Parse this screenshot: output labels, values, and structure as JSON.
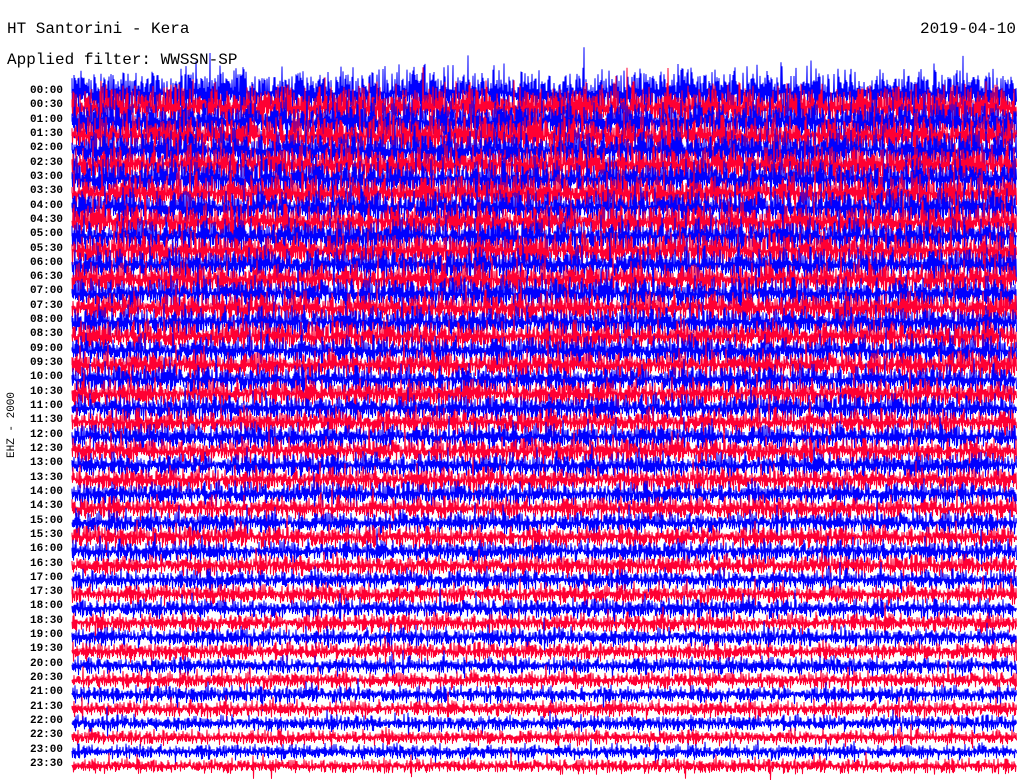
{
  "header": {
    "title": "HT Santorini - Kera",
    "filter": "Applied filter: WWSSN-SP",
    "date": "2019-04-10"
  },
  "chart_data": {
    "type": "line",
    "title": "HT Santorini - Kera",
    "subtitle": "Applied filter: WWSSN-SP",
    "date": "2019-04-10",
    "ylabel": "EHZ - 2000",
    "row_labels": [
      "00:00",
      "00:30",
      "01:00",
      "01:30",
      "02:00",
      "02:30",
      "03:00",
      "03:30",
      "04:00",
      "04:30",
      "05:00",
      "05:30",
      "06:00",
      "06:30",
      "07:00",
      "07:30",
      "08:00",
      "08:30",
      "09:00",
      "09:30",
      "10:00",
      "10:30",
      "11:00",
      "11:30",
      "12:00",
      "12:30",
      "13:00",
      "13:30",
      "14:00",
      "14:30",
      "15:00",
      "15:30",
      "16:00",
      "16:30",
      "17:00",
      "17:30",
      "18:00",
      "18:30",
      "19:00",
      "19:30",
      "20:00",
      "20:30",
      "21:00",
      "21:30",
      "22:00",
      "22:30",
      "23:00",
      "23:30"
    ],
    "trace_colors": [
      "#0000ff",
      "#ff0033"
    ],
    "relative_amplitude_start": 1.0,
    "relative_amplitude_end": 0.3
  }
}
